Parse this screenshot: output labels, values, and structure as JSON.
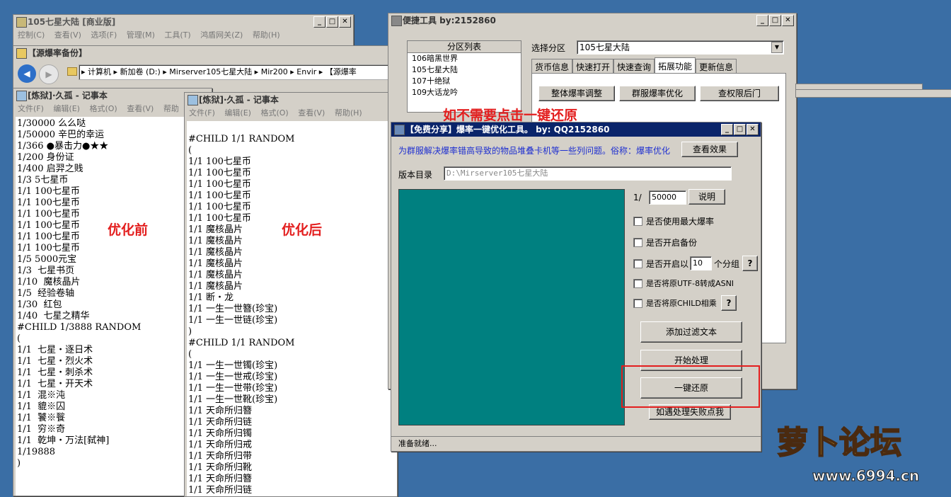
{
  "desktop": {
    "bg": "#3a6ea5"
  },
  "win_main": {
    "title": "105七星大陆 [商业版]",
    "menu": [
      "控制(C)",
      "查看(V)",
      "选项(F)",
      "管理(M)",
      "工具(T)",
      "鸿盾网关(Z)",
      "帮助(H)"
    ]
  },
  "explorer": {
    "title": "【源爆率备份】",
    "path": "▸ 计算机 ▸ 新加卷 (D:) ▸ Mirserver105七星大陆 ▸ Mir200 ▸ Envir ▸ 【源爆率"
  },
  "notepad1": {
    "title": "[炼狱]·久孤 - 记事本",
    "menu": [
      "文件(F)",
      "编辑(E)",
      "格式(O)",
      "查看(V)",
      "帮助"
    ],
    "lines": [
      "1/30000 么么哒",
      "1/50000 辛巴的幸运",
      "1/366 ●暴击力●★★",
      "1/200 身份证",
      "1/400 启羿之贱",
      "1/3 5七星币",
      "1/1 100七星币",
      "1/1 100七星币",
      "1/1 100七星币",
      "1/1 100七星币",
      "1/1 100七星币",
      "1/1 100七星币",
      "1/5 5000元宝",
      "1/3  七星书页",
      "1/10  魔核晶片",
      "1/5  经验卷轴",
      "1/30  红包",
      "1/40  七星之精华",
      "#CHILD 1/3888 RANDOM",
      "(",
      "1/1  七星・逐日术",
      "1/1  七星・烈火术",
      "1/1  七星・刺杀术",
      "1/1  七星・开天术",
      "1/1  混※沌",
      "1/1  貔※囚",
      "1/1  饕※餮",
      "1/1  穷※奇",
      "1/1  乾坤・万法[弑神]",
      "1/19888",
      ")"
    ]
  },
  "notepad2": {
    "title": "[炼狱]·久孤 - 记事本",
    "menu": [
      "文件(F)",
      "编辑(E)",
      "格式(O)",
      "查看(V)",
      "帮助(H)"
    ],
    "lines": [
      "",
      "#CHILD 1/1 RANDOM",
      "(",
      "1/1 100七星币",
      "1/1 100七星币",
      "1/1 100七星币",
      "1/1 100七星币",
      "1/1 100七星币",
      "1/1 100七星币",
      "1/1 魔核晶片",
      "1/1 魔核晶片",
      "1/1 魔核晶片",
      "1/1 魔核晶片",
      "1/1 魔核晶片",
      "1/1 魔核晶片",
      "1/1 断・龙",
      "1/1 一生一世簪(珍宝)",
      "1/1 一生一世链(珍宝)",
      ")",
      "#CHILD 1/1 RANDOM",
      "(",
      "1/1 一生一世镯(珍宝)",
      "1/1 一生一世戒(珍宝)",
      "1/1 一生一世带(珍宝)",
      "1/1 一生一世靴(珍宝)",
      "1/1 天命所归簪",
      "1/1 天命所归链",
      "1/1 天命所归镯",
      "1/1 天命所归戒",
      "1/1 天命所归带",
      "1/1 天命所归靴",
      "1/1 天命所归簪",
      "1/1 天命所归链"
    ]
  },
  "annotations": {
    "before": "优化前",
    "after": "优化后",
    "hint": "如不需要点击一键还原"
  },
  "quicktool": {
    "title": "便捷工具   by:2152860",
    "list_header": "分区列表",
    "list_items": [
      "106暗黑世界",
      "105七星大陆",
      "107十绝狱",
      "109大话龙吟"
    ],
    "select_label": "选择分区",
    "select_value": "105七星大陆",
    "tabs": [
      "货币信息",
      "快速打开",
      "快速查询",
      "拓展功能",
      "更新信息"
    ],
    "buttons": [
      "整体爆率调整",
      "群服爆率优化",
      "查权限后门"
    ]
  },
  "optimizer": {
    "title": "【免费分享】爆率一键优化工具。   by: QQ2152860",
    "description": "为群服解决爆率错高导致的物品堆叠卡机等一些列问题。俗称：爆率优化",
    "view_effect": "查看效果",
    "dir_label": "版本目录",
    "dir_value": "D:\\Mirserver105七星大陆",
    "ratio_prefix": "1/",
    "ratio_value": "50000",
    "explain": "说明",
    "opt_max": "是否使用最大爆率",
    "opt_backup": "是否开启备份",
    "opt_group_prefix": "是否开启以",
    "opt_group_value": "10",
    "opt_group_suffix": "个分组",
    "opt_utf8": "是否将原UTF-8转成ASNI",
    "opt_child": "是否将原CHILD相乘",
    "help": "?",
    "btn_filter": "添加过滤文本",
    "btn_start": "开始处理",
    "btn_restore": "一键还原",
    "btn_fail": "如遇处理失败点我",
    "status": "准备就绪...",
    "panel_color": "#008080"
  },
  "watermark": {
    "brand": "萝卜论坛",
    "url": "www.6994.cn"
  }
}
